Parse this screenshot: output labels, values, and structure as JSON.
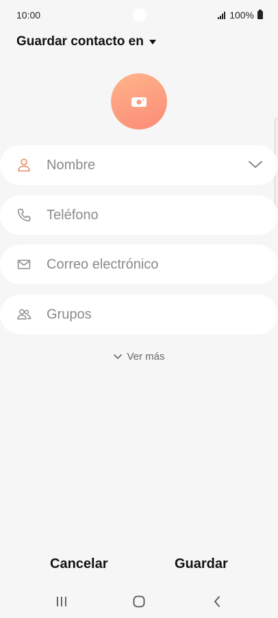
{
  "status_bar": {
    "time": "10:00",
    "battery_text": "100%"
  },
  "header": {
    "save_in_label": "Guardar contacto en"
  },
  "fields": [
    {
      "label": "Nombre",
      "icon": "person-icon"
    },
    {
      "label": "Teléfono",
      "icon": "phone-icon"
    },
    {
      "label": "Correo electrónico",
      "icon": "mail-icon"
    },
    {
      "label": "Grupos",
      "icon": "groups-icon"
    }
  ],
  "more": {
    "label": "Ver más"
  },
  "actions": {
    "cancel_label": "Cancelar",
    "save_label": "Guardar"
  },
  "colors": {
    "accent": "#fb8b78",
    "background": "#f6f6f6"
  }
}
